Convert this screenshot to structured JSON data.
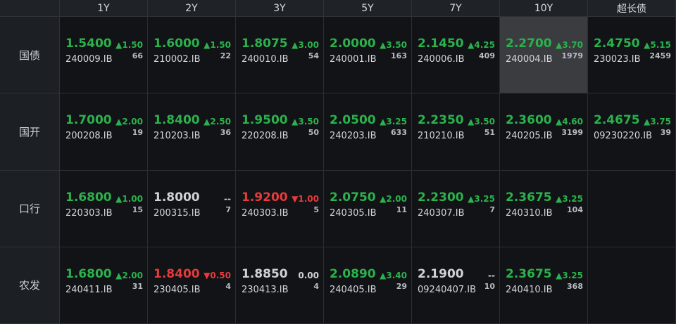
{
  "columns": [
    "1Y",
    "2Y",
    "3Y",
    "5Y",
    "7Y",
    "10Y",
    "超长债"
  ],
  "rows": [
    {
      "label": "国债",
      "cells": [
        {
          "yield": "1.5400",
          "yield_color": "green",
          "change": "▲1.50",
          "change_color": "green",
          "volume": "66",
          "code": "240009.IB"
        },
        {
          "yield": "1.6000",
          "yield_color": "green",
          "change": "▲1.50",
          "change_color": "green",
          "volume": "22",
          "code": "210002.IB"
        },
        {
          "yield": "1.8075",
          "yield_color": "green",
          "change": "▲3.00",
          "change_color": "green",
          "volume": "54",
          "code": "240010.IB"
        },
        {
          "yield": "2.0000",
          "yield_color": "green",
          "change": "▲3.50",
          "change_color": "green",
          "volume": "163",
          "code": "240001.IB"
        },
        {
          "yield": "2.1450",
          "yield_color": "green",
          "change": "▲4.25",
          "change_color": "green",
          "volume": "409",
          "code": "240006.IB"
        },
        {
          "yield": "2.2700",
          "yield_color": "green",
          "change": "▲3.70",
          "change_color": "green",
          "volume": "1979",
          "code": "240004.IB",
          "highlight": true
        },
        {
          "yield": "2.4750",
          "yield_color": "green",
          "change": "▲5.15",
          "change_color": "green",
          "volume": "2459",
          "code": "230023.IB"
        }
      ]
    },
    {
      "label": "国开",
      "cells": [
        {
          "yield": "1.7000",
          "yield_color": "green",
          "change": "▲2.00",
          "change_color": "green",
          "volume": "19",
          "code": "200208.IB"
        },
        {
          "yield": "1.8400",
          "yield_color": "green",
          "change": "▲2.50",
          "change_color": "green",
          "volume": "36",
          "code": "210203.IB"
        },
        {
          "yield": "1.9500",
          "yield_color": "green",
          "change": "▲3.50",
          "change_color": "green",
          "volume": "50",
          "code": "220208.IB"
        },
        {
          "yield": "2.0500",
          "yield_color": "green",
          "change": "▲3.25",
          "change_color": "green",
          "volume": "633",
          "code": "240203.IB"
        },
        {
          "yield": "2.2350",
          "yield_color": "green",
          "change": "▲3.50",
          "change_color": "green",
          "volume": "51",
          "code": "210210.IB"
        },
        {
          "yield": "2.3600",
          "yield_color": "green",
          "change": "▲4.60",
          "change_color": "green",
          "volume": "3199",
          "code": "240205.IB"
        },
        {
          "yield": "2.4675",
          "yield_color": "green",
          "change": "▲3.75",
          "change_color": "green",
          "volume": "39",
          "code": "09230220.IB"
        }
      ]
    },
    {
      "label": "口行",
      "cells": [
        {
          "yield": "1.6800",
          "yield_color": "green",
          "change": "▲1.00",
          "change_color": "green",
          "volume": "15",
          "code": "220303.IB"
        },
        {
          "yield": "1.8000",
          "yield_color": "white",
          "change": "--",
          "change_color": "white",
          "volume": "7",
          "code": "200315.IB"
        },
        {
          "yield": "1.9200",
          "yield_color": "red",
          "change": "▼1.00",
          "change_color": "red",
          "volume": "5",
          "code": "240303.IB"
        },
        {
          "yield": "2.0750",
          "yield_color": "green",
          "change": "▲2.00",
          "change_color": "green",
          "volume": "11",
          "code": "240305.IB"
        },
        {
          "yield": "2.2300",
          "yield_color": "green",
          "change": "▲3.25",
          "change_color": "green",
          "volume": "7",
          "code": "240307.IB"
        },
        {
          "yield": "2.3675",
          "yield_color": "green",
          "change": "▲3.25",
          "change_color": "green",
          "volume": "104",
          "code": "240310.IB"
        },
        null
      ]
    },
    {
      "label": "农发",
      "cells": [
        {
          "yield": "1.6800",
          "yield_color": "green",
          "change": "▲2.00",
          "change_color": "green",
          "volume": "31",
          "code": "240411.IB"
        },
        {
          "yield": "1.8400",
          "yield_color": "red",
          "change": "▼0.50",
          "change_color": "red",
          "volume": "4",
          "code": "230405.IB"
        },
        {
          "yield": "1.8850",
          "yield_color": "white",
          "change": "0.00",
          "change_color": "white",
          "volume": "4",
          "code": "230413.IB"
        },
        {
          "yield": "2.0890",
          "yield_color": "green",
          "change": "▲3.40",
          "change_color": "green",
          "volume": "29",
          "code": "240405.IB"
        },
        {
          "yield": "2.1900",
          "yield_color": "white",
          "change": "--",
          "change_color": "white",
          "volume": "10",
          "code": "09240407.IB"
        },
        {
          "yield": "2.3675",
          "yield_color": "green",
          "change": "▲3.25",
          "change_color": "green",
          "volume": "368",
          "code": "240410.IB"
        },
        null
      ]
    }
  ]
}
